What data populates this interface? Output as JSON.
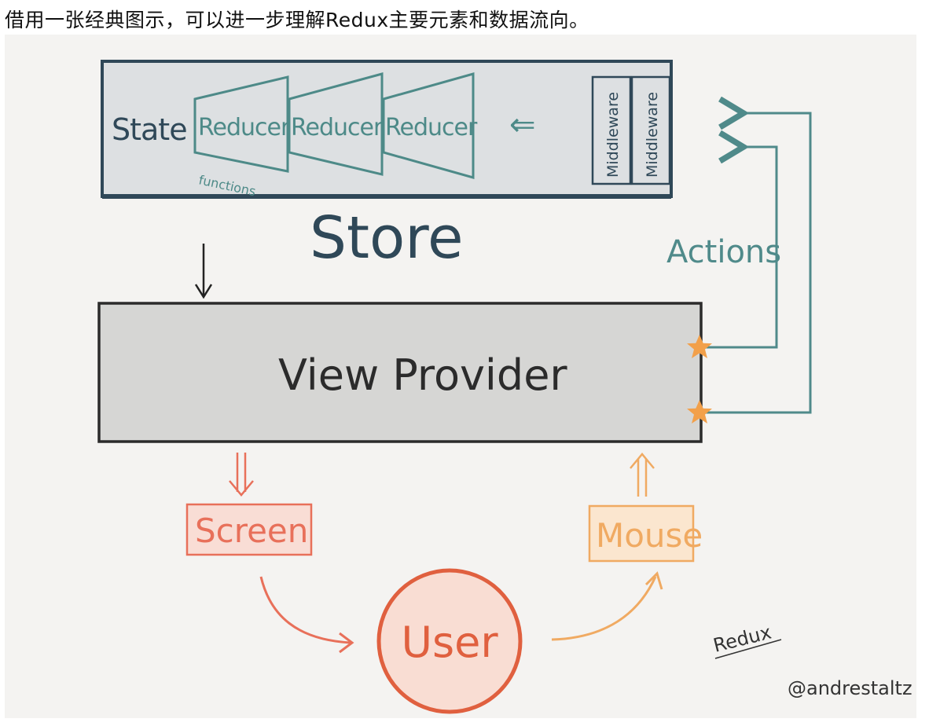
{
  "caption": "借用一张经典图示，可以进一步理解Redux主要元素和数据流向。",
  "diagram": {
    "store": {
      "label": "Store",
      "state_label": "State",
      "reducers": [
        "Reducer",
        "Reducer",
        "Reducer"
      ],
      "functions_label": "functions",
      "middleware": [
        "Middleware",
        "Middleware"
      ],
      "arrow_glyph": "⇐"
    },
    "view_provider": {
      "label": "View Provider"
    },
    "actions": {
      "label": "Actions"
    },
    "screen": {
      "label": "Screen"
    },
    "mouse": {
      "label": "Mouse"
    },
    "user": {
      "label": "User"
    },
    "signature": {
      "title": "Redux",
      "author": "@andrestaltz"
    },
    "colors": {
      "store_fill": "#dde0e2",
      "store_stroke": "#2f4858",
      "reducer_stroke": "#4d8a88",
      "actions": "#4f8a8a",
      "view_fill": "#d6d6d4",
      "star": "#f2a04a",
      "screen": "#e8705a",
      "mouse": "#f0aa62",
      "user": "#e0603f"
    }
  }
}
